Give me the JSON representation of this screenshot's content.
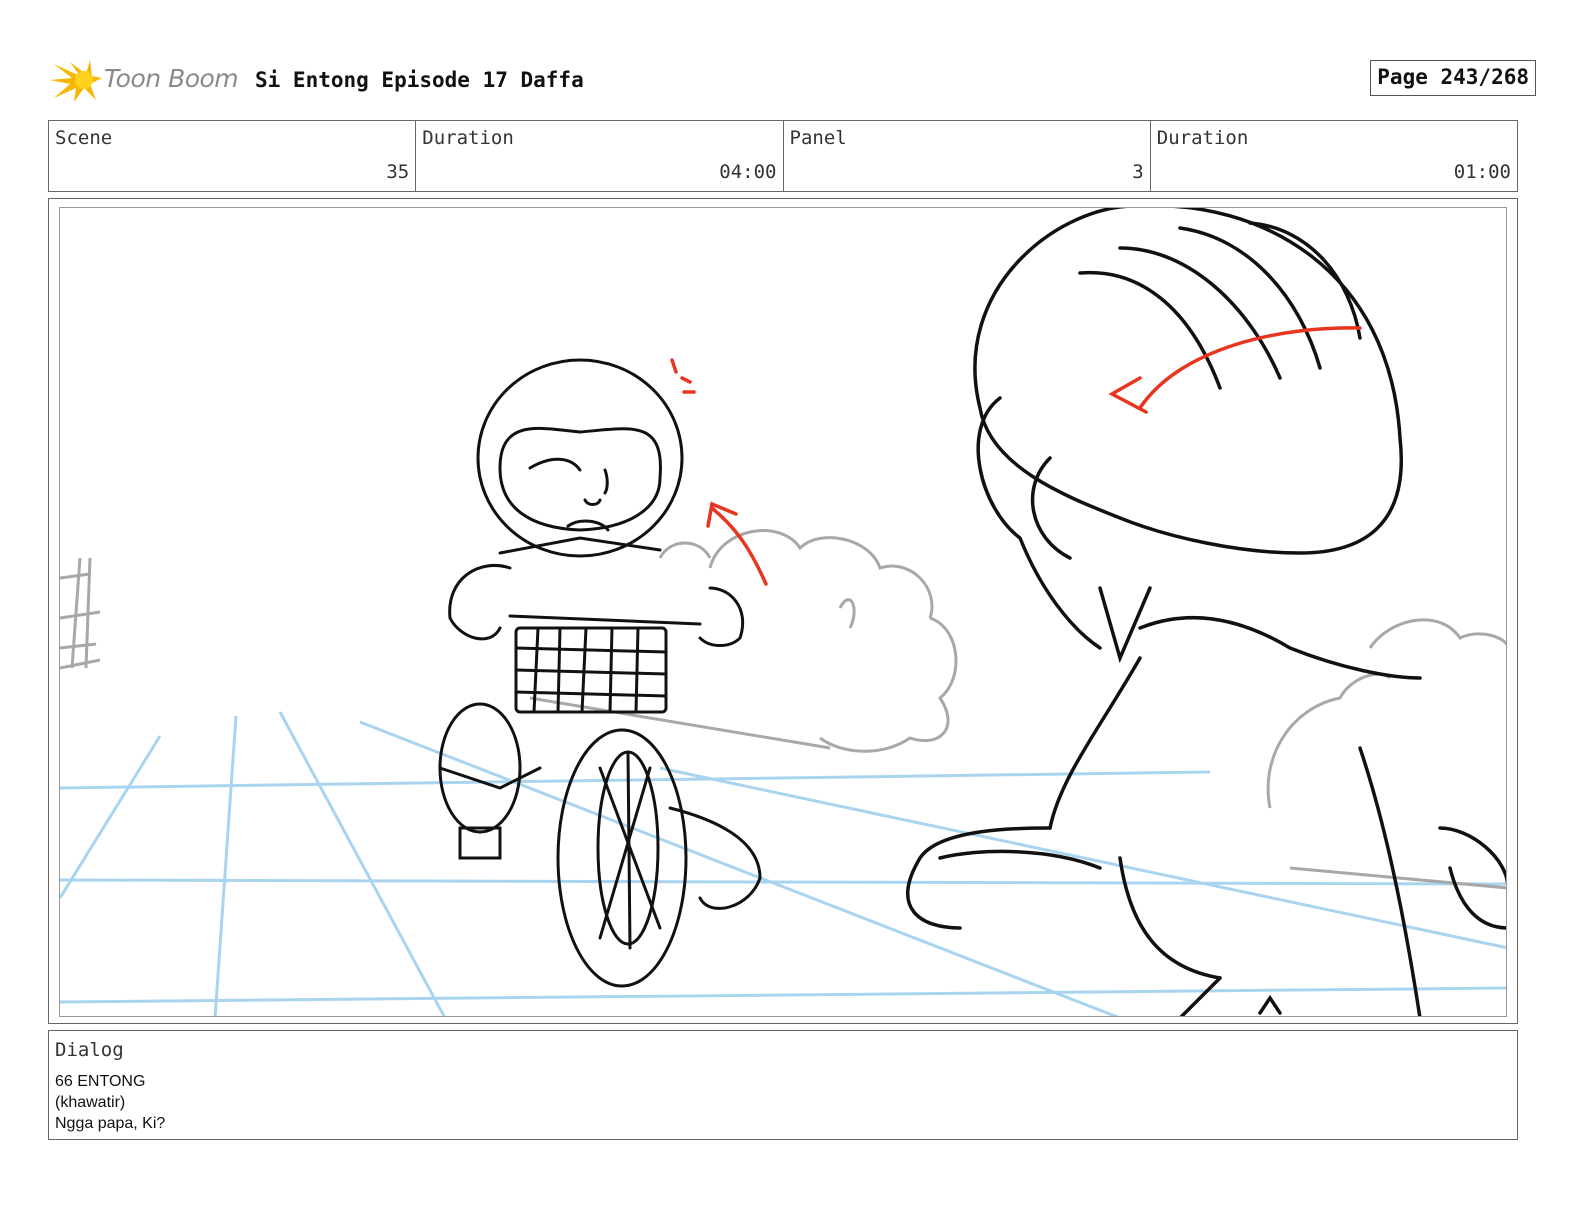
{
  "header": {
    "logo_text": "Toon Boom",
    "title": "Si Entong Episode 17 Daffa",
    "page": "Page 243/268"
  },
  "info": {
    "scene_label": "Scene",
    "scene_value": "35",
    "scene_duration_label": "Duration",
    "scene_duration_value": "04:00",
    "panel_label": "Panel",
    "panel_value": "3",
    "panel_duration_label": "Duration",
    "panel_duration_value": "01:00"
  },
  "dialog": {
    "label": "Dialog",
    "lines": [
      "66 ENTONG",
      "(khawatir)",
      "Ngga papa, Ki?"
    ]
  },
  "colors": {
    "sketch_line": "#111111",
    "arrow_red": "#e8351f",
    "guide_blue": "#a9d4f0",
    "background_grey": "#a8a8a8",
    "logo_star": "#f5b800"
  }
}
